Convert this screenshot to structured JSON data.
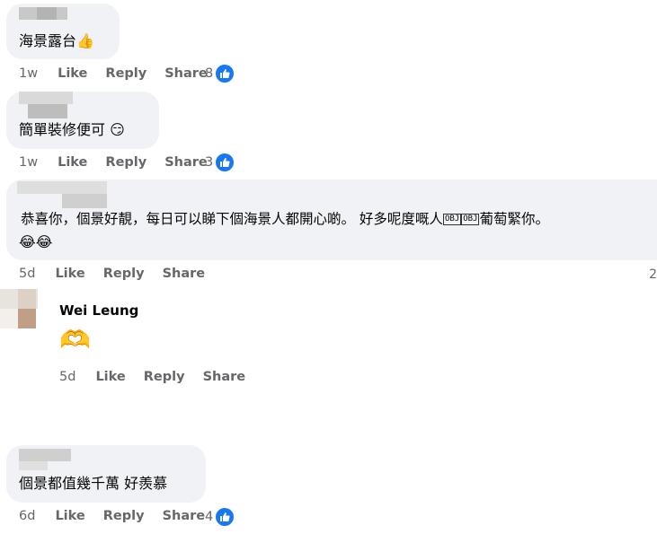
{
  "comments": [
    {
      "text": "海景露台",
      "emoji": "👍",
      "time": "1w",
      "like": "Like",
      "reply": "Reply",
      "share": "Share",
      "reactions": "8"
    },
    {
      "text": "簡單裝修便可",
      "emoji": "😏",
      "time": "1w",
      "like": "Like",
      "reply": "Reply",
      "share": "Share",
      "reactions": "3"
    },
    {
      "text_line1_a": "恭喜你，個景好靚，每日可以睇下個海景人都開心啲。 好多呢度嘅人",
      "obj1": "OBJ",
      "obj2": "OBJ",
      "text_line1_b": "葡萄緊你。",
      "emoji_line2": "😂😂",
      "time": "5d",
      "like": "Like",
      "reply": "Reply",
      "share": "Share",
      "edge_char": "2"
    },
    {
      "text": "個景都值幾千萬 好羨慕",
      "time": "6d",
      "like": "Like",
      "reply": "Reply",
      "share": "Share",
      "reactions": "4"
    }
  ],
  "reply": {
    "name": "Wei Leung",
    "emoji": "🫶",
    "time": "5d",
    "like": "Like",
    "reply": "Reply",
    "share": "Share"
  },
  "colors": {
    "bubble": "#f0f2f5",
    "meta": "#65676b",
    "like_blue": "#1877f2"
  }
}
